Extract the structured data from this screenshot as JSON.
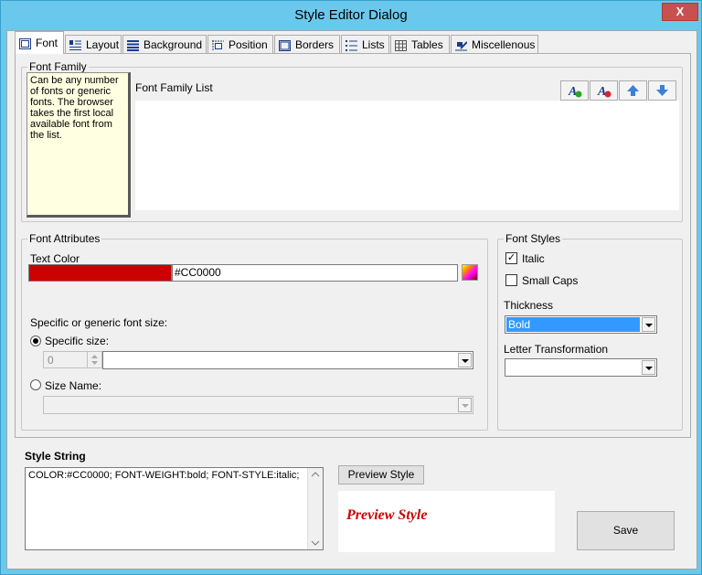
{
  "window": {
    "title": "Style Editor Dialog",
    "close_glyph": "X"
  },
  "tabs": [
    {
      "label": "Font",
      "icon": "font-tab-icon",
      "active": true
    },
    {
      "label": "Layout",
      "icon": "layout-tab-icon"
    },
    {
      "label": "Background",
      "icon": "background-tab-icon"
    },
    {
      "label": "Position",
      "icon": "position-tab-icon"
    },
    {
      "label": "Borders",
      "icon": "borders-tab-icon"
    },
    {
      "label": "Lists",
      "icon": "lists-tab-icon"
    },
    {
      "label": "Tables",
      "icon": "tables-tab-icon"
    },
    {
      "label": "Miscellenous",
      "icon": "miscellenous-tab-icon"
    }
  ],
  "font_family": {
    "legend": "Font Family",
    "help_text": "Can be any number of fonts or generic fonts. The browser takes the first local available font from the list.",
    "list_label": "Font Family List",
    "toolbar_icons": [
      "add-font-icon",
      "remove-font-icon",
      "move-up-icon",
      "move-down-icon"
    ]
  },
  "font_attributes": {
    "legend": "Font Attributes",
    "text_color_label": "Text Color",
    "text_color_value": "#CC0000",
    "size_label": "Specific or generic font size:",
    "specific_size_label": "Specific size:",
    "specific_size_value": "0",
    "size_name_label": "Size Name:"
  },
  "font_styles": {
    "legend": "Font Styles",
    "italic_label": "Italic",
    "italic_checked": true,
    "small_caps_label": "Small Caps",
    "small_caps_checked": false,
    "thickness_label": "Thickness",
    "thickness_value": "Bold",
    "letter_transformation_label": "Letter Transformation",
    "letter_transformation_value": ""
  },
  "style_string": {
    "label": "Style String",
    "value": "COLOR:#CC0000; FONT-WEIGHT:bold; FONT-STYLE:italic;",
    "preview_button": "Preview Style",
    "preview_text": "Preview Style",
    "save_button": "Save"
  },
  "colors": {
    "accent": "#6ac8ec",
    "text_color": "#cc0000",
    "selection": "#3399ff"
  }
}
